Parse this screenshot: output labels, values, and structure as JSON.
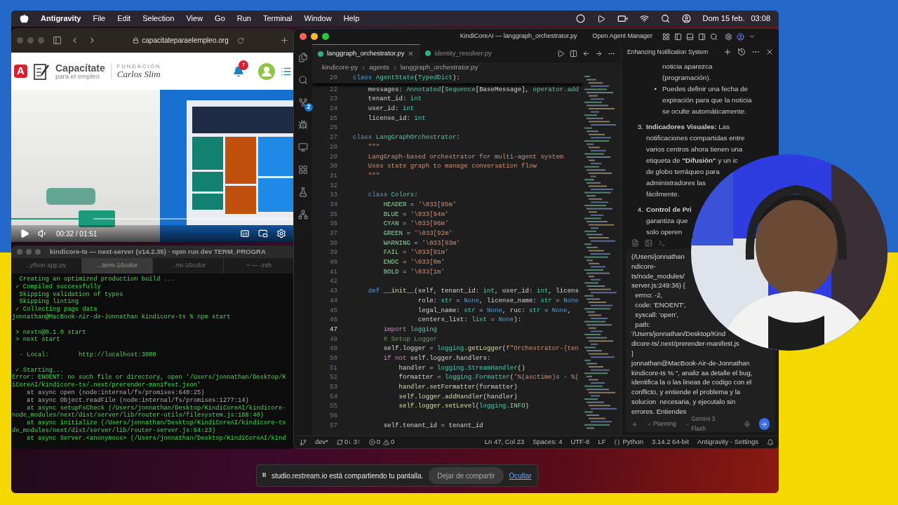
{
  "menu_bar": {
    "app": "Antigravity",
    "items": [
      "File",
      "Edit",
      "Selection",
      "View",
      "Go",
      "Run",
      "Terminal",
      "Window",
      "Help"
    ],
    "date": "Dom 15 feb.",
    "time": "03:08"
  },
  "browser": {
    "url": "capacitateparaelempleo.org",
    "site": {
      "badge": "A",
      "brand_title": "Capacítate",
      "brand_subtitle": "para el empleo",
      "partner_top": "FUNDACIÓN",
      "partner_name": "Carlos Slim",
      "notification_count": "7"
    },
    "video": {
      "kind": "picture",
      "time": "00:32 / 01:51",
      "level": 0.29
    }
  },
  "terminal": {
    "title": "kindicore-ts — next-server (v14.2.35) · npm run dev TERM_PROGRA",
    "tabs": [
      {
        "label": "..ython app.py",
        "selected": false
      },
      {
        "label": "...term-16color",
        "selected": true
      },
      {
        "label": "...rm-16color",
        "selected": false
      },
      {
        "label": "~ — -zsh",
        "selected": false
      }
    ],
    "lines": [
      {
        "kind": "output",
        "text": "  Creating an optimized production build ..."
      },
      {
        "kind": "output",
        "text": " ✓ Compiled successfully"
      },
      {
        "kind": "output",
        "text": "  Skipping validation of types"
      },
      {
        "kind": "output",
        "text": "  Skipping linting"
      },
      {
        "kind": "output",
        "text": " ✓ Collecting page data"
      },
      {
        "kind": "output",
        "text": "jonnathan@MacBook-Air-de-Jonnathan kindicore-ts % npm start"
      },
      {
        "kind": "blank"
      },
      {
        "kind": "output",
        "text": " > nextn@0.1.0 start"
      },
      {
        "kind": "output",
        "text": " > next start"
      },
      {
        "kind": "blank"
      },
      {
        "kind": "output",
        "text": "  - Local:        http://localhost:3000"
      },
      {
        "kind": "blank"
      },
      {
        "kind": "output",
        "text": " ✓ Starting..."
      },
      {
        "kind": "output",
        "text": "Error: ENOENT: no such file or directory, open '/Users/jonnathan/Desktop/K"
      },
      {
        "kind": "output",
        "text": "iCoreAI/kindicore-ts/.next/prerender-manifest.json'"
      },
      {
        "kind": "trace",
        "text": "    at async open (node:internal/fs/promises:640:25)"
      },
      {
        "kind": "trace",
        "text": "    at async Object.readFile (node:internal/fs/promises:1277:14)"
      },
      {
        "kind": "output",
        "text": "    at async setupFsCheck (/Users/jonnathan/Desktop/KindiCoreAI/kindicore-"
      },
      {
        "kind": "output",
        "text": "node_modules/next/dist/server/lib/router-utils/filesystem.js:188:40)"
      },
      {
        "kind": "output",
        "text": "    at async initialize (/Users/jonnathan/Desktop/KindiCoreAI/kindicore-ts"
      },
      {
        "kind": "output",
        "text": "de_modules/next/dist/server/lib/router-server.js:64:23)"
      },
      {
        "kind": "output",
        "text": "    at async Server.<anonymous> (/Users/jonnathan/Desktop/KindiCoreAI/kind"
      }
    ]
  },
  "editor": {
    "title": "KindiCoreAI — langgraph_orchestrator.py",
    "agent_manager": "Open Agent Manager",
    "scm_badge": "2",
    "tabs": [
      {
        "label": "langgraph_orchestrator.py",
        "selected": true
      },
      {
        "label": "identity_resolver.py",
        "selected": false
      }
    ],
    "breadcrumb": [
      "kindicore-py",
      "agents",
      "langgraph_orchestrator.py"
    ],
    "sticky": {
      "n": "20",
      "tokens": [
        {
          "text": "class ",
          "kind": "keyword"
        },
        {
          "text": "AgentState",
          "kind": "type"
        },
        {
          "text": "(",
          "kind": "plain"
        },
        {
          "text": "TypedDict",
          "kind": "type"
        },
        {
          "text": "):",
          "kind": "plain"
        }
      ]
    },
    "lines": [
      {
        "n": "22",
        "current": false,
        "tokens": [
          {
            "text": "    messages: ",
            "kind": "plain"
          },
          {
            "text": "Annotated",
            "kind": "type"
          },
          {
            "text": "[",
            "kind": "function"
          },
          {
            "text": "Sequence",
            "kind": "type"
          },
          {
            "text": "[BaseMessage], ",
            "kind": "plain"
          },
          {
            "text": "operator.add",
            "kind": "type"
          }
        ]
      },
      {
        "n": "23",
        "current": false,
        "tokens": [
          {
            "text": "    tenant_id: ",
            "kind": "plain"
          },
          {
            "text": "int",
            "kind": "type"
          }
        ]
      },
      {
        "n": "24",
        "current": false,
        "tokens": [
          {
            "text": "    user_id: ",
            "kind": "plain"
          },
          {
            "text": "int",
            "kind": "type"
          }
        ]
      },
      {
        "n": "25",
        "current": false,
        "tokens": [
          {
            "text": "    license_id: ",
            "kind": "plain"
          },
          {
            "text": "int",
            "kind": "type"
          }
        ]
      },
      {
        "n": "26",
        "current": false
      },
      {
        "n": "27",
        "current": false,
        "tokens": [
          {
            "text": "class ",
            "kind": "keyword"
          },
          {
            "text": "LangGraphOrchestrator",
            "kind": "type"
          },
          {
            "text": ":",
            "kind": "plain"
          }
        ]
      },
      {
        "n": "28",
        "current": false,
        "tokens": [
          {
            "text": "    \"\"\"",
            "kind": "string"
          }
        ]
      },
      {
        "n": "29",
        "current": false,
        "tokens": [
          {
            "text": "    LangGraph-based orchestrator for multi-agent system",
            "kind": "string"
          }
        ]
      },
      {
        "n": "30",
        "current": false,
        "tokens": [
          {
            "text": "    Uses state graph to manage conversation flow",
            "kind": "string"
          }
        ]
      },
      {
        "n": "31",
        "current": false,
        "tokens": [
          {
            "text": "    \"\"\"",
            "kind": "string"
          }
        ]
      },
      {
        "n": "32",
        "current": false
      },
      {
        "n": "33",
        "current": false,
        "tokens": [
          {
            "text": "    class ",
            "kind": "keyword"
          },
          {
            "text": "Colors",
            "kind": "type"
          },
          {
            "text": ":",
            "kind": "plain"
          }
        ]
      },
      {
        "n": "34",
        "current": false,
        "tokens": [
          {
            "text": "        HEADER",
            "kind": "constant"
          },
          {
            "text": " = ",
            "kind": "plain"
          },
          {
            "text": "'\\033[95m'",
            "kind": "string"
          }
        ]
      },
      {
        "n": "35",
        "current": false,
        "tokens": [
          {
            "text": "        BLUE",
            "kind": "constant"
          },
          {
            "text": " = ",
            "kind": "plain"
          },
          {
            "text": "'\\033[94m'",
            "kind": "string"
          }
        ]
      },
      {
        "n": "36",
        "current": false,
        "tokens": [
          {
            "text": "        CYAN",
            "kind": "constant"
          },
          {
            "text": " = ",
            "kind": "plain"
          },
          {
            "text": "'\\033[96m'",
            "kind": "string"
          }
        ]
      },
      {
        "n": "37",
        "current": false,
        "tokens": [
          {
            "text": "        GREEN",
            "kind": "constant"
          },
          {
            "text": " = ",
            "kind": "plain"
          },
          {
            "text": "'\\033[92m'",
            "kind": "string"
          }
        ]
      },
      {
        "n": "38",
        "current": false,
        "tokens": [
          {
            "text": "        WARNING",
            "kind": "constant"
          },
          {
            "text": " = ",
            "kind": "plain"
          },
          {
            "text": "'\\033[93m'",
            "kind": "string"
          }
        ]
      },
      {
        "n": "39",
        "current": false,
        "tokens": [
          {
            "text": "        FAIL",
            "kind": "constant"
          },
          {
            "text": " = ",
            "kind": "plain"
          },
          {
            "text": "'\\033[91m'",
            "kind": "string"
          }
        ]
      },
      {
        "n": "40",
        "current": false,
        "tokens": [
          {
            "text": "        ENDC",
            "kind": "constant"
          },
          {
            "text": " = ",
            "kind": "plain"
          },
          {
            "text": "'\\033[0m'",
            "kind": "string"
          }
        ]
      },
      {
        "n": "41",
        "current": false,
        "tokens": [
          {
            "text": "        BOLD",
            "kind": "constant"
          },
          {
            "text": " = ",
            "kind": "plain"
          },
          {
            "text": "'\\033[1m'",
            "kind": "string"
          }
        ]
      },
      {
        "n": "42",
        "current": false
      },
      {
        "n": "43",
        "current": false,
        "tokens": [
          {
            "text": "    def ",
            "kind": "keyword"
          },
          {
            "text": "__init__",
            "kind": "function"
          },
          {
            "text": "(self, tenant_id: ",
            "kind": "plain"
          },
          {
            "text": "int",
            "kind": "type"
          },
          {
            "text": ", user_id: ",
            "kind": "plain"
          },
          {
            "text": "int",
            "kind": "type"
          },
          {
            "text": ", licens",
            "kind": "plain"
          }
        ]
      },
      {
        "n": "44",
        "current": false,
        "tokens": [
          {
            "text": "                 role: ",
            "kind": "plain"
          },
          {
            "text": "str",
            "kind": "type"
          },
          {
            "text": " = ",
            "kind": "plain"
          },
          {
            "text": "None",
            "kind": "keyword"
          },
          {
            "text": ", license_name: ",
            "kind": "plain"
          },
          {
            "text": "str",
            "kind": "type"
          },
          {
            "text": " = ",
            "kind": "plain"
          },
          {
            "text": "None",
            "kind": "keyword"
          }
        ]
      },
      {
        "n": "45",
        "current": false,
        "tokens": [
          {
            "text": "                 legal_name: ",
            "kind": "plain"
          },
          {
            "text": "str",
            "kind": "type"
          },
          {
            "text": " = ",
            "kind": "plain"
          },
          {
            "text": "None",
            "kind": "keyword"
          },
          {
            "text": ", ruc: ",
            "kind": "plain"
          },
          {
            "text": "str",
            "kind": "type"
          },
          {
            "text": " = ",
            "kind": "plain"
          },
          {
            "text": "None",
            "kind": "keyword"
          },
          {
            "text": ",",
            "kind": "plain"
          }
        ]
      },
      {
        "n": "46",
        "current": false,
        "tokens": [
          {
            "text": "                 centers_list: ",
            "kind": "plain"
          },
          {
            "text": "list",
            "kind": "type"
          },
          {
            "text": " = ",
            "kind": "plain"
          },
          {
            "text": "None",
            "kind": "keyword"
          },
          {
            "text": "):",
            "kind": "plain"
          }
        ]
      },
      {
        "n": "47",
        "current": true,
        "tokens": [
          {
            "text": "        import ",
            "kind": "control"
          },
          {
            "text": "logging",
            "kind": "type"
          }
        ]
      },
      {
        "n": "48",
        "current": false,
        "tokens": [
          {
            "text": "        # Setup Logger",
            "kind": "comment"
          }
        ]
      },
      {
        "n": "49",
        "current": false,
        "tokens": [
          {
            "text": "        self.logger = ",
            "kind": "plain"
          },
          {
            "text": "logging",
            "kind": "type"
          },
          {
            "text": ".getLogger",
            "kind": "function"
          },
          {
            "text": "(",
            "kind": "plain"
          },
          {
            "text": "f\"Orchestrator-{ten",
            "kind": "string"
          }
        ]
      },
      {
        "n": "50",
        "current": false,
        "tokens": [
          {
            "text": "        if not ",
            "kind": "control"
          },
          {
            "text": "self.logger.handlers:",
            "kind": "plain"
          }
        ]
      },
      {
        "n": "51",
        "current": false,
        "tokens": [
          {
            "text": "            handler = ",
            "kind": "plain"
          },
          {
            "text": "logging.StreamHandler",
            "kind": "type"
          },
          {
            "text": "()",
            "kind": "function"
          }
        ]
      },
      {
        "n": "52",
        "current": false,
        "tokens": [
          {
            "text": "            formatter = ",
            "kind": "plain"
          },
          {
            "text": "logging.Formatter",
            "kind": "type"
          },
          {
            "text": "(",
            "kind": "function"
          },
          {
            "text": "'%(asctime)s - %(",
            "kind": "string"
          }
        ]
      },
      {
        "n": "53",
        "current": false,
        "tokens": [
          {
            "text": "            handler.setFormatter",
            "kind": "function"
          },
          {
            "text": "(formatter)",
            "kind": "plain"
          }
        ]
      },
      {
        "n": "54",
        "current": false,
        "tokens": [
          {
            "text": "            self.logger.addHandler",
            "kind": "function"
          },
          {
            "text": "(handler)",
            "kind": "plain"
          }
        ]
      },
      {
        "n": "55",
        "current": false,
        "tokens": [
          {
            "text": "            self.logger.setLevel",
            "kind": "function"
          },
          {
            "text": "(",
            "kind": "plain"
          },
          {
            "text": "logging",
            "kind": "type"
          },
          {
            "text": ".INFO",
            "kind": "constant"
          },
          {
            "text": ")",
            "kind": "plain"
          }
        ]
      },
      {
        "n": "56",
        "current": false
      },
      {
        "n": "57",
        "current": false,
        "tokens": [
          {
            "text": "        self.tenant_id = tenant_id",
            "kind": "plain"
          }
        ]
      }
    ],
    "status_bar": {
      "branch": "dev*",
      "sync": "0↓ 3↑",
      "errors": "0",
      "warnings": "0",
      "position": "Ln 47, Col 23",
      "spaces": "Spaces: 4",
      "encoding": "UTF-8",
      "eol": "LF",
      "language": "Python",
      "interpreter": "3.14.2 64-bit",
      "settings": "Antigravity - Settings"
    }
  },
  "chat": {
    "title": "Enhancing Notification System",
    "continuation": [
      "noticia aparezca",
      "(programación)."
    ],
    "bullets": [
      {
        "marker": "•",
        "lines": [
          "Puedes definir una fecha de",
          "expiración para que la noticia",
          "se oculte automáticamente."
        ]
      }
    ],
    "items": [
      {
        "marker": "3.",
        "lines": [
          "**Indicadores Visuales:** Las",
          "notificaciones compartidas entre",
          "varios centros ahora tienen una",
          "etiqueta de **\"Difusión\"** y un ic",
          "de globo terráqueo para",
          "administradores las",
          "fácilmente."
        ]
      },
      {
        "marker": "4.",
        "lines": [
          "**Control de Pri**",
          "garantiza que",
          "solo operen"
        ]
      }
    ],
    "input_lines": [
      "(/Users/jonnathan",
      "ndicore-",
      "ts/node_modules/",
      "server.js:249:36) {",
      "  errno: -2,",
      "  code: 'ENOENT',",
      "  syscall: 'open',",
      "  path:",
      "'/Users/jonnathan/Desktop/Kind",
      "dicore-ts/.next/prerender-manifest.js",
      "}",
      "jonnathan@MacBook-Air-de-Jonnathan",
      "kindicore-ts % \", analiz aa detalle el bug,",
      "identifica la o las lineas de codigo con el",
      "conflicto, y entiende el problema y la",
      "solucion  necesaria, y ejecutalo sin",
      "errores. Entiendes"
    ],
    "mode": "Planning",
    "model": "Gemini 3 Flash"
  },
  "share_notice": {
    "icon": "II",
    "message": "studio.restream.io está compartiendo tu pantalla.",
    "stop": "Dejar de compartir",
    "hide": "Ocultar"
  }
}
